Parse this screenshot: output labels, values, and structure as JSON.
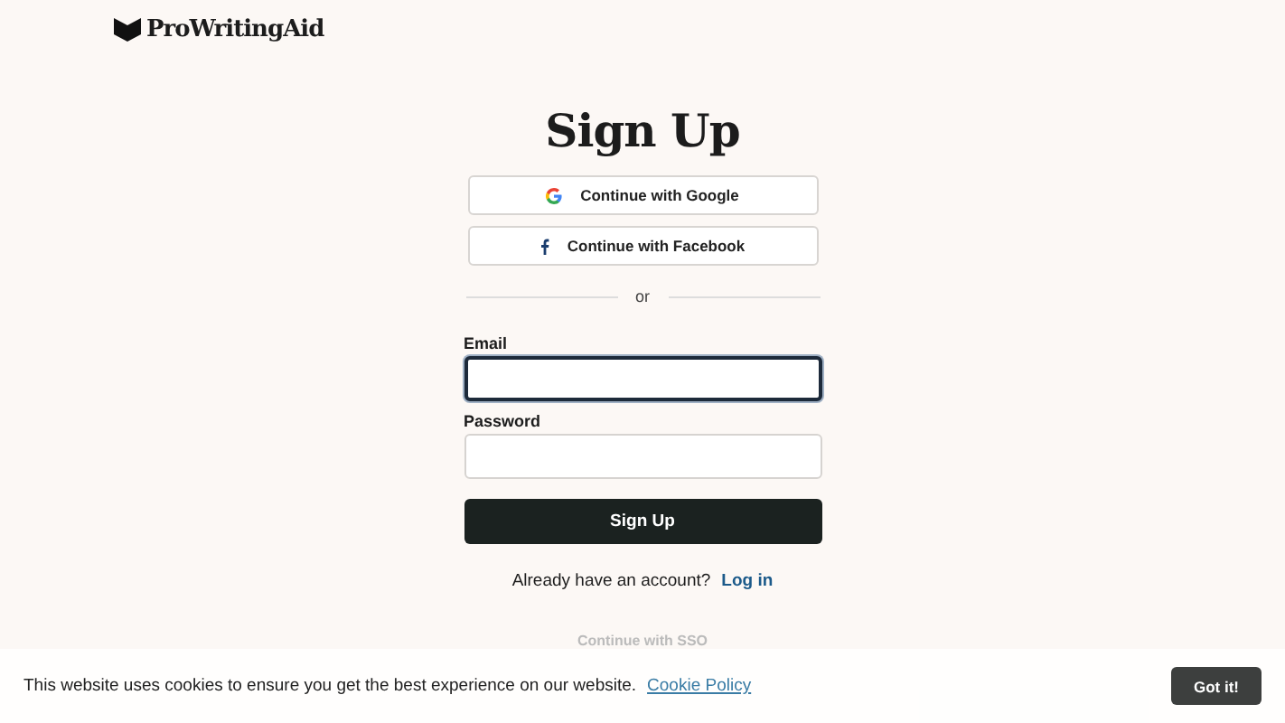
{
  "header": {
    "logo": "ProWritingAid"
  },
  "form": {
    "title": "Sign Up",
    "social_buttons": [
      {
        "kind": "google",
        "label": "Continue with Google"
      },
      {
        "kind": "facebook",
        "label": "Continue with Facebook"
      }
    ],
    "divider": "or",
    "fields": [
      {
        "label": "Email",
        "focused": true
      },
      {
        "label": "Password",
        "focused": false
      }
    ],
    "submit": "Sign Up",
    "login_prompt": "Already have an account?",
    "login_link": "Log in",
    "sso": "Continue with SSO"
  },
  "cookie_banner": {
    "message": "This website uses cookies to ensure you get the best experience on our website.",
    "policy_link": "Cookie Policy",
    "button": "Got it!"
  }
}
